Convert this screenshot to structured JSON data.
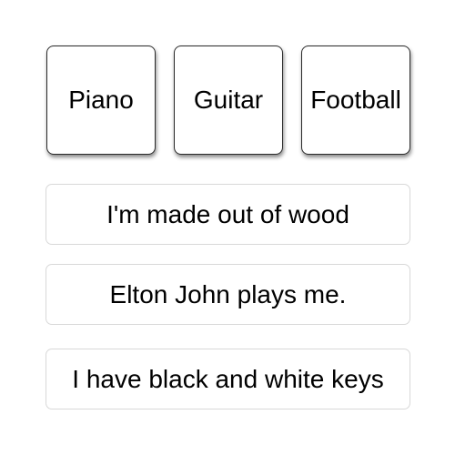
{
  "choices": [
    {
      "label": "Piano"
    },
    {
      "label": "Guitar"
    },
    {
      "label": "Football"
    }
  ],
  "clues": [
    {
      "text": "I'm made out of wood"
    },
    {
      "text": "Elton John plays me."
    },
    {
      "text": "I have black and white keys"
    }
  ]
}
